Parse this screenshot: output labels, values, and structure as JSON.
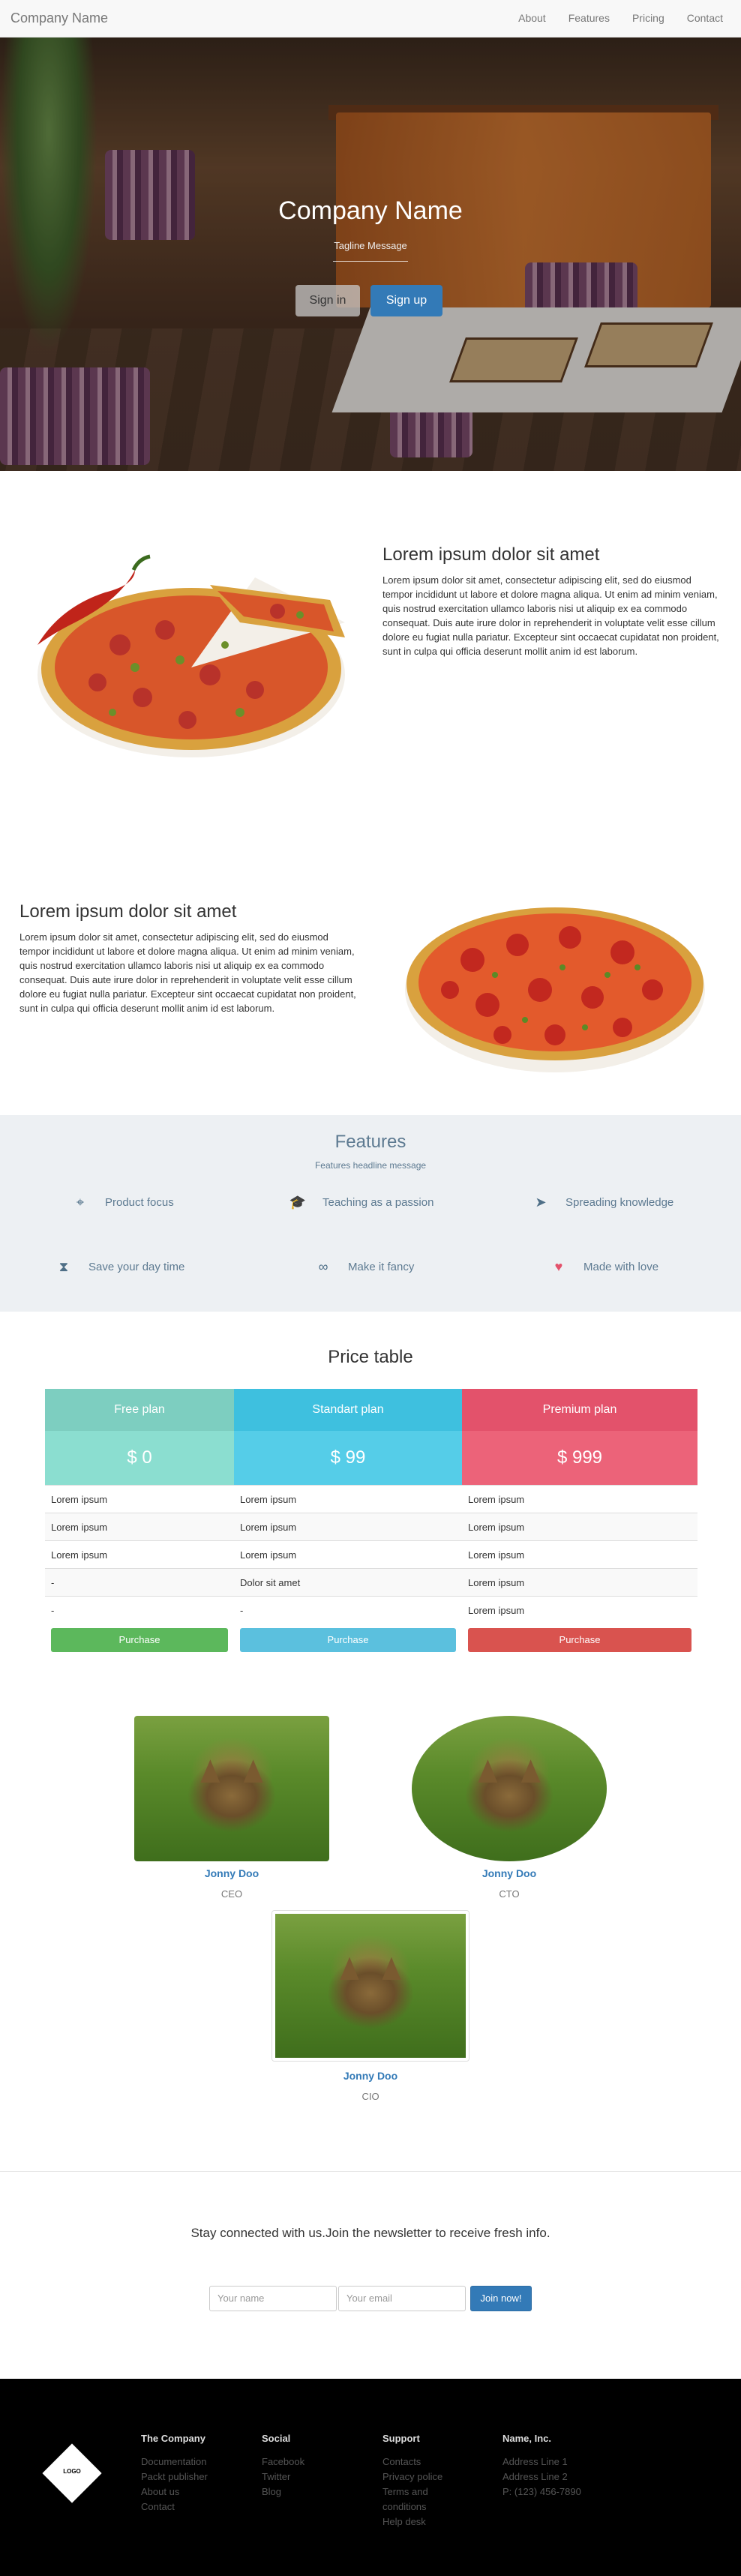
{
  "nav": {
    "brand": "Company Name",
    "links": [
      "About",
      "Features",
      "Pricing",
      "Contact"
    ]
  },
  "hero": {
    "title": "Company Name",
    "tagline": "Tagline Message",
    "signin": "Sign in",
    "signup": "Sign up"
  },
  "rows": [
    {
      "title": "Lorem ipsum dolor sit amet",
      "text": "Lorem ipsum dolor sit amet, consectetur adipiscing elit, sed do eiusmod tempor incididunt ut labore et dolore magna aliqua. Ut enim ad minim veniam, quis nostrud exercitation ullamco laboris nisi ut aliquip ex ea commodo consequat. Duis aute irure dolor in reprehenderit in voluptate velit esse cillum dolore eu fugiat nulla pariatur. Excepteur sint occaecat cupidatat non proident, sunt in culpa qui officia deserunt mollit anim id est laborum."
    },
    {
      "title": "Lorem ipsum dolor sit amet",
      "text": "Lorem ipsum dolor sit amet, consectetur adipiscing elit, sed do eiusmod tempor incididunt ut labore et dolore magna aliqua. Ut enim ad minim veniam, quis nostrud exercitation ullamco laboris nisi ut aliquip ex ea commodo consequat. Duis aute irure dolor in reprehenderit in voluptate velit esse cillum dolore eu fugiat nulla pariatur. Excepteur sint occaecat cupidatat non proident, sunt in culpa qui officia deserunt mollit anim id est laborum."
    }
  ],
  "features": {
    "title": "Features",
    "subtitle": "Features headline message",
    "items": [
      {
        "label": "Product focus",
        "icon": "crosshair-icon"
      },
      {
        "label": "Teaching as a passion",
        "icon": "graduation-cap-icon"
      },
      {
        "label": "Spreading knowledge",
        "icon": "paper-plane-icon"
      },
      {
        "label": "Save your day time",
        "icon": "hourglass-icon"
      },
      {
        "label": "Make it fancy",
        "icon": "glasses-icon"
      },
      {
        "label": "Made with love",
        "icon": "heart-icon"
      }
    ]
  },
  "pricing": {
    "title": "Price table",
    "plans": [
      {
        "name": "Free plan",
        "price": "$ 0",
        "rows": [
          "Lorem ipsum",
          "Lorem ipsum",
          "Lorem ipsum",
          "-",
          "-"
        ],
        "button": "Purchase",
        "head_color": "#7dcec0",
        "price_color": "#8bded0",
        "button_color": "#5cb85c"
      },
      {
        "name": "Standart plan",
        "price": "$ 99",
        "rows": [
          "Lorem ipsum",
          "Lorem ipsum",
          "Lorem ipsum",
          "Dolor sit amet",
          "-"
        ],
        "button": "Purchase",
        "head_color": "#3ec0df",
        "price_color": "#55cde8",
        "button_color": "#5bc0de"
      },
      {
        "name": "Premium plan",
        "price": "$ 999",
        "rows": [
          "Lorem ipsum",
          "Lorem ipsum",
          "Lorem ipsum",
          "Lorem ipsum",
          "Lorem ipsum"
        ],
        "button": "Purchase",
        "head_color": "#e3526b",
        "price_color": "#ec6379",
        "button_color": "#d9534f"
      }
    ]
  },
  "team": [
    {
      "name": "Jonny Doo",
      "role": "CEO"
    },
    {
      "name": "Jonny Doo",
      "role": "CTO"
    },
    {
      "name": "Jonny Doo",
      "role": "CIO"
    }
  ],
  "newsletter": {
    "text": "Stay connected with us.Join the newsletter to receive fresh info.",
    "name_placeholder": "Your name",
    "email_placeholder": "Your email",
    "button": "Join now!"
  },
  "footer": {
    "logo": "LOGO",
    "columns": [
      {
        "heading": "The Company",
        "links": [
          "Documentation",
          "Packt publisher",
          "About us",
          "Contact"
        ]
      },
      {
        "heading": "Social",
        "links": [
          "Facebook",
          "Twitter",
          "Blog"
        ]
      },
      {
        "heading": "Support",
        "links": [
          "Contacts",
          "Privacy police",
          "Terms and conditions",
          "Help desk"
        ]
      },
      {
        "heading": "Name, Inc.",
        "links": [
          "Address Line 1",
          "Address Line 2",
          "P: (123) 456-7890"
        ]
      }
    ]
  }
}
